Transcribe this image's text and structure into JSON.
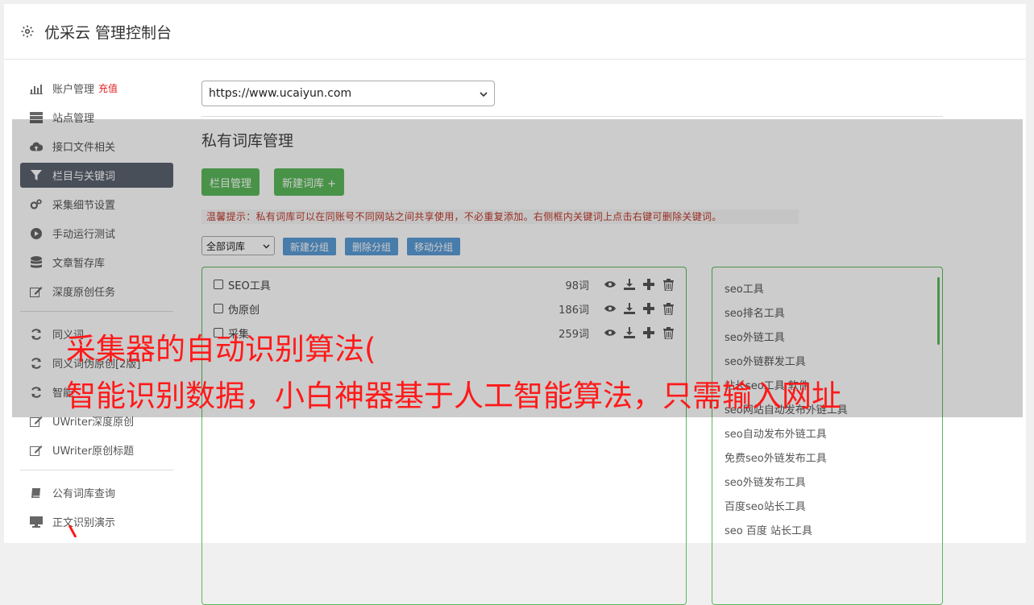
{
  "app": {
    "title": "优采云 管理控制台"
  },
  "sidebar": {
    "group1": [
      {
        "label": "账户管理",
        "badge": "充值",
        "icon": "bar-chart-icon"
      },
      {
        "label": "站点管理",
        "icon": "server-icon"
      },
      {
        "label": "接口文件相关",
        "icon": "cloud-upload-icon"
      },
      {
        "label": "栏目与关键词",
        "icon": "filter-icon",
        "active": true
      },
      {
        "label": "采集细节设置",
        "icon": "gears-icon"
      },
      {
        "label": "手动运行测试",
        "icon": "play-icon"
      },
      {
        "label": "文章暂存库",
        "icon": "database-icon"
      },
      {
        "label": "深度原创任务",
        "icon": "edit-icon"
      }
    ],
    "group2": [
      {
        "label": "同义词",
        "icon": "refresh-icon"
      },
      {
        "label": "同义词伪原创[2版]",
        "icon": "refresh-icon"
      },
      {
        "label": "智能",
        "icon": "refresh-icon"
      },
      {
        "label": "UWriter深度原创",
        "icon": "edit-icon"
      },
      {
        "label": "UWriter原创标题",
        "icon": "edit-icon"
      }
    ],
    "group3": [
      {
        "label": "公有词库查询",
        "icon": "book-icon"
      },
      {
        "label": "正文识别演示",
        "icon": "monitor-icon"
      }
    ]
  },
  "main": {
    "site_select": "https://www.ucaiyun.com",
    "section_title": "私有词库管理",
    "btn_column_manage": "栏目管理",
    "btn_new_library": "新建词库 +",
    "tip": "温馨提示：私有词库可以在同账号不同网站之间共享使用，不必重复添加。右侧框内关键词上点击右键可删除关键词。",
    "library_filter": "全部词库",
    "btn_new_group": "新建分组",
    "btn_delete_group": "删除分组",
    "btn_move_group": "移动分组",
    "libraries": [
      {
        "name": "SEO工具",
        "count": "98词"
      },
      {
        "name": "伪原创",
        "count": "186词"
      },
      {
        "name": "采集",
        "count": "259词"
      }
    ],
    "keywords": [
      "seo工具",
      "seo排名工具",
      "seo外链工具",
      "seo外链群发工具",
      "站长seo工具 软件",
      "seo网站自动发布外链工具",
      "seo自动发布外链工具",
      "免费seo外链发布工具",
      "seo外链发布工具",
      "百度seo站长工具",
      "seo 百度 站长工具"
    ]
  },
  "overlay_caption": {
    "line1": "采集器的自动识别算法(",
    "line2": "智能识别数据，小白神器基于人工智能算法，只需输入网址"
  },
  "colors": {
    "active_nav": "#5b6370",
    "green": "#5cb85c",
    "blue": "#5b9bd5",
    "caption_red": "#ff1a1a",
    "tip_red": "#c0392b"
  }
}
